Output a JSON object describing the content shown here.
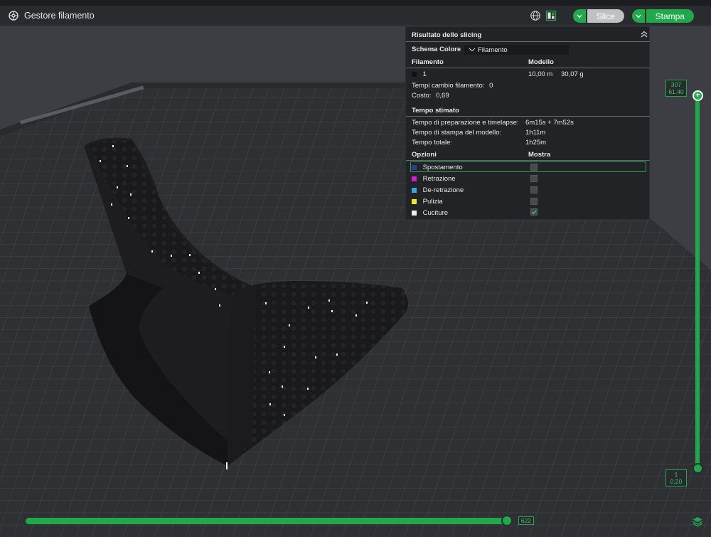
{
  "toolbar": {
    "filament_manager_label": "Gestore filamento",
    "slice_label": "Slice",
    "print_label": "Stampa"
  },
  "panel": {
    "title": "Risultato dello slicing",
    "color_scheme_label": "Schema Colore",
    "color_scheme_value": "Filamento",
    "col_filament": "Filamento",
    "col_model": "Modello",
    "filament_row": {
      "id": "1",
      "length": "10,00 m",
      "weight": "30,07 g"
    },
    "filament_changes_label": "Tempi cambio filamento:",
    "filament_changes_value": "0",
    "cost_label": "Costo:",
    "cost_value": "0,69",
    "time_header": "Tempo stimato",
    "prep_time_label": "Tempo di preparazione e timelapse:",
    "prep_time_value": "6m15s + 7m52s",
    "model_print_time_label": "Tempo di stampa del modello:",
    "model_print_time_value": "1h11m",
    "total_time_label": "Tempo totale:",
    "total_time_value": "1h25m",
    "options_header": "Opzioni",
    "show_header": "Mostra",
    "options": [
      {
        "label": "Spostamento",
        "color": "#2a3f8f",
        "checked": false
      },
      {
        "label": "Retrazione",
        "color": "#d21fd0",
        "checked": false
      },
      {
        "label": "De-retrazione",
        "color": "#3ba6cf",
        "checked": false
      },
      {
        "label": "Pulizia",
        "color": "#f2e61e",
        "checked": false
      },
      {
        "label": "Cuciture",
        "color": "#f0f0f0",
        "checked": true
      }
    ]
  },
  "layer_slider": {
    "top_layer": "307",
    "top_height": "61.40",
    "bottom_layer": "1",
    "bottom_height": "0,20"
  },
  "move_slider": {
    "value": "622"
  },
  "colors": {
    "accent": "#1fa94a",
    "panel_bg": "#222327",
    "viewport_bg": "#3d3e44"
  }
}
